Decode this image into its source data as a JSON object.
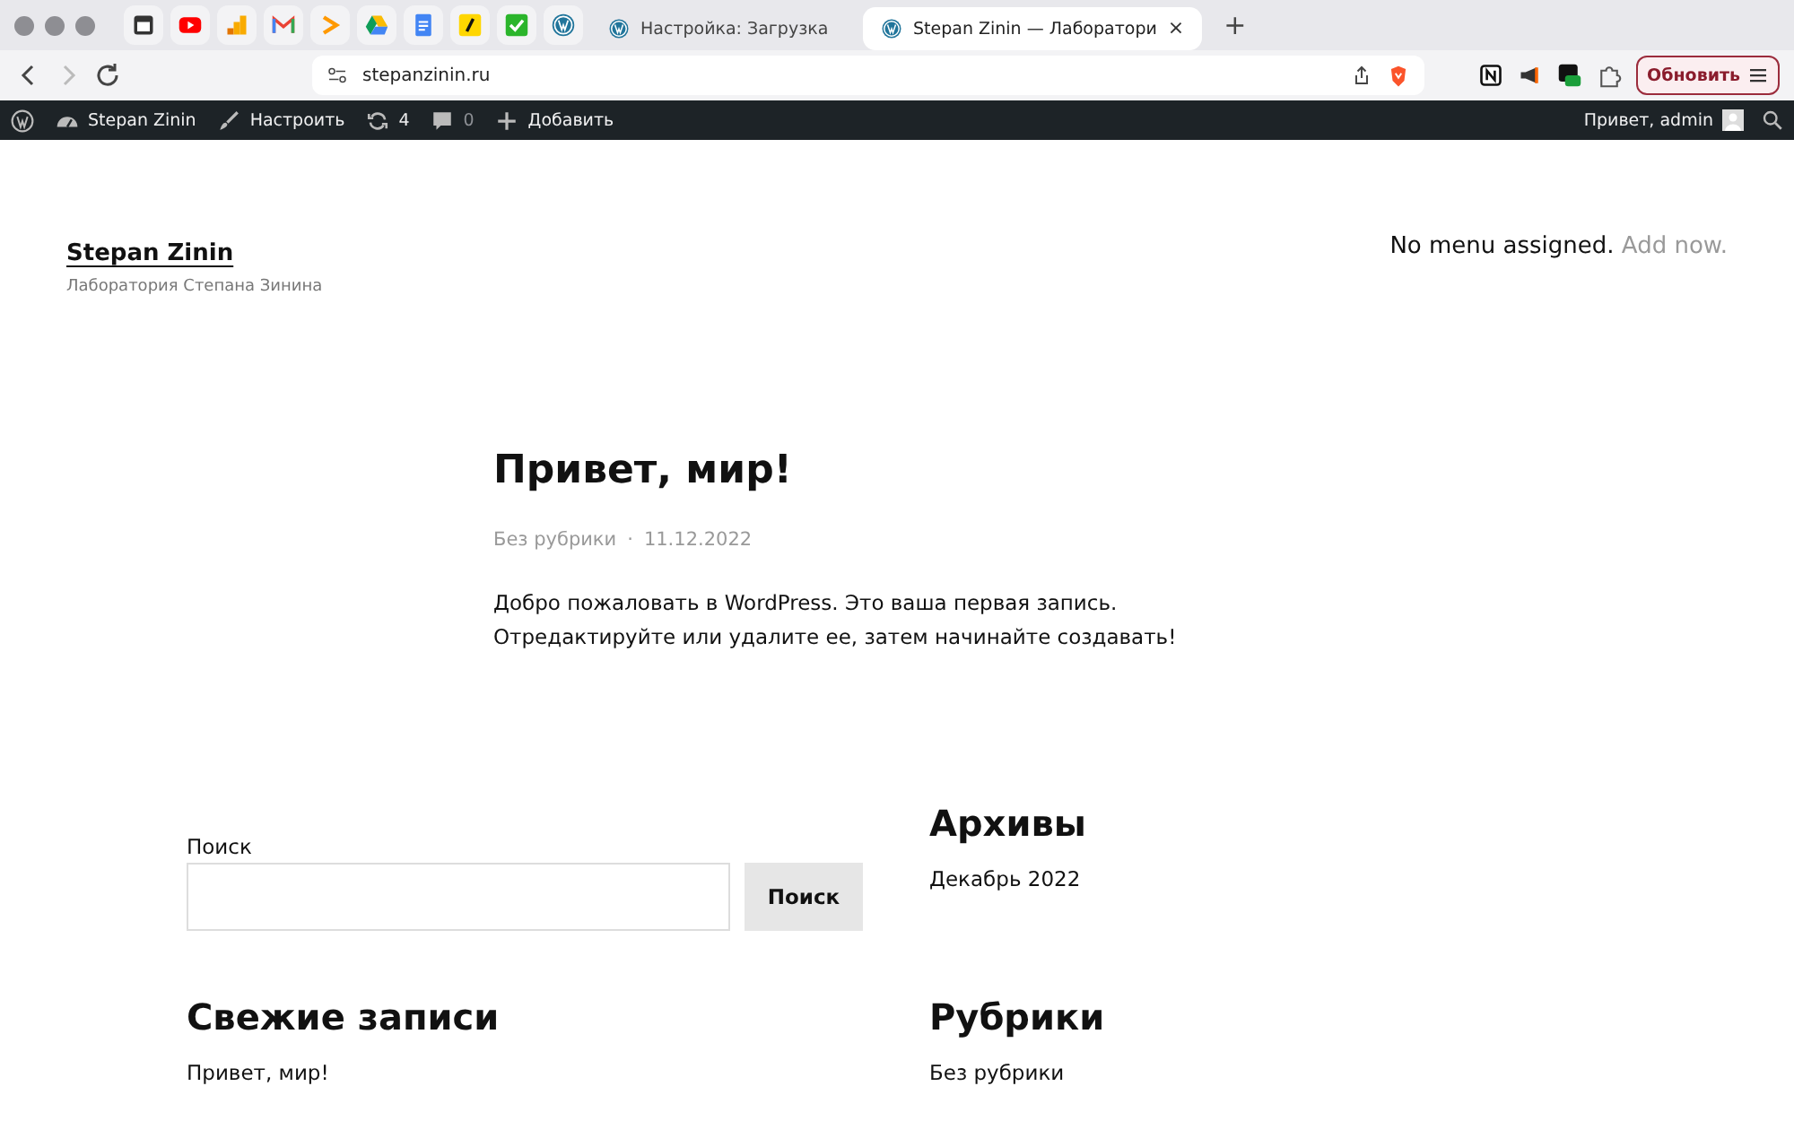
{
  "browser": {
    "pinned_tabs": [
      {
        "kind": "calendar"
      },
      {
        "kind": "video"
      },
      {
        "kind": "bars"
      },
      {
        "kind": "mail"
      },
      {
        "kind": "chevron"
      },
      {
        "kind": "drive"
      },
      {
        "kind": "doc"
      },
      {
        "kind": "slash"
      },
      {
        "kind": "check"
      },
      {
        "kind": "wordpress"
      }
    ],
    "tabs": [
      {
        "title": "Настройка: Загрузка",
        "selected": false
      },
      {
        "title": "Stepan Zinin — Лаборатори",
        "selected": true
      }
    ],
    "tab_close": "×",
    "new_tab": "+",
    "address": {
      "value": "stepanzinin.ru"
    },
    "extensions": [
      {
        "kind": "notion"
      },
      {
        "kind": "megaphone"
      },
      {
        "kind": "terminal"
      },
      {
        "kind": "puzzle"
      }
    ],
    "update_button": {
      "label": "Обновить"
    }
  },
  "admin_bar": {
    "items": [
      {
        "kind": "wordpress"
      },
      {
        "kind": "dashboard",
        "label": "Stepan Zinin"
      },
      {
        "kind": "brush",
        "label": "Настроить"
      },
      {
        "kind": "updates",
        "label": "4"
      },
      {
        "kind": "comments",
        "label": "0"
      },
      {
        "kind": "add",
        "label": "Добавить"
      }
    ],
    "greeting": "Привет, admin"
  },
  "site": {
    "title": "Stepan Zinin",
    "tagline": "Лаборатория Степана Зинина",
    "menu_note": "No menu assigned.",
    "menu_link": "Add now."
  },
  "post": {
    "title": "Привет, мир!",
    "category": "Без рубрики",
    "separator": "·",
    "date": "11.12.2022",
    "body": "Добро пожаловать в WordPress. Это ваша первая запись. Отредактируйте или удалите ее, затем начинайте создавать!"
  },
  "widgets": {
    "search": {
      "label": "Поиск",
      "button": "Поиск"
    },
    "archives": {
      "heading": "Архивы",
      "items": [
        "Декабрь 2022"
      ]
    },
    "recent": {
      "heading": "Свежие записи",
      "items": [
        "Привет, мир!"
      ]
    },
    "categories": {
      "heading": "Рубрики",
      "items": [
        "Без рубрики"
      ]
    }
  }
}
